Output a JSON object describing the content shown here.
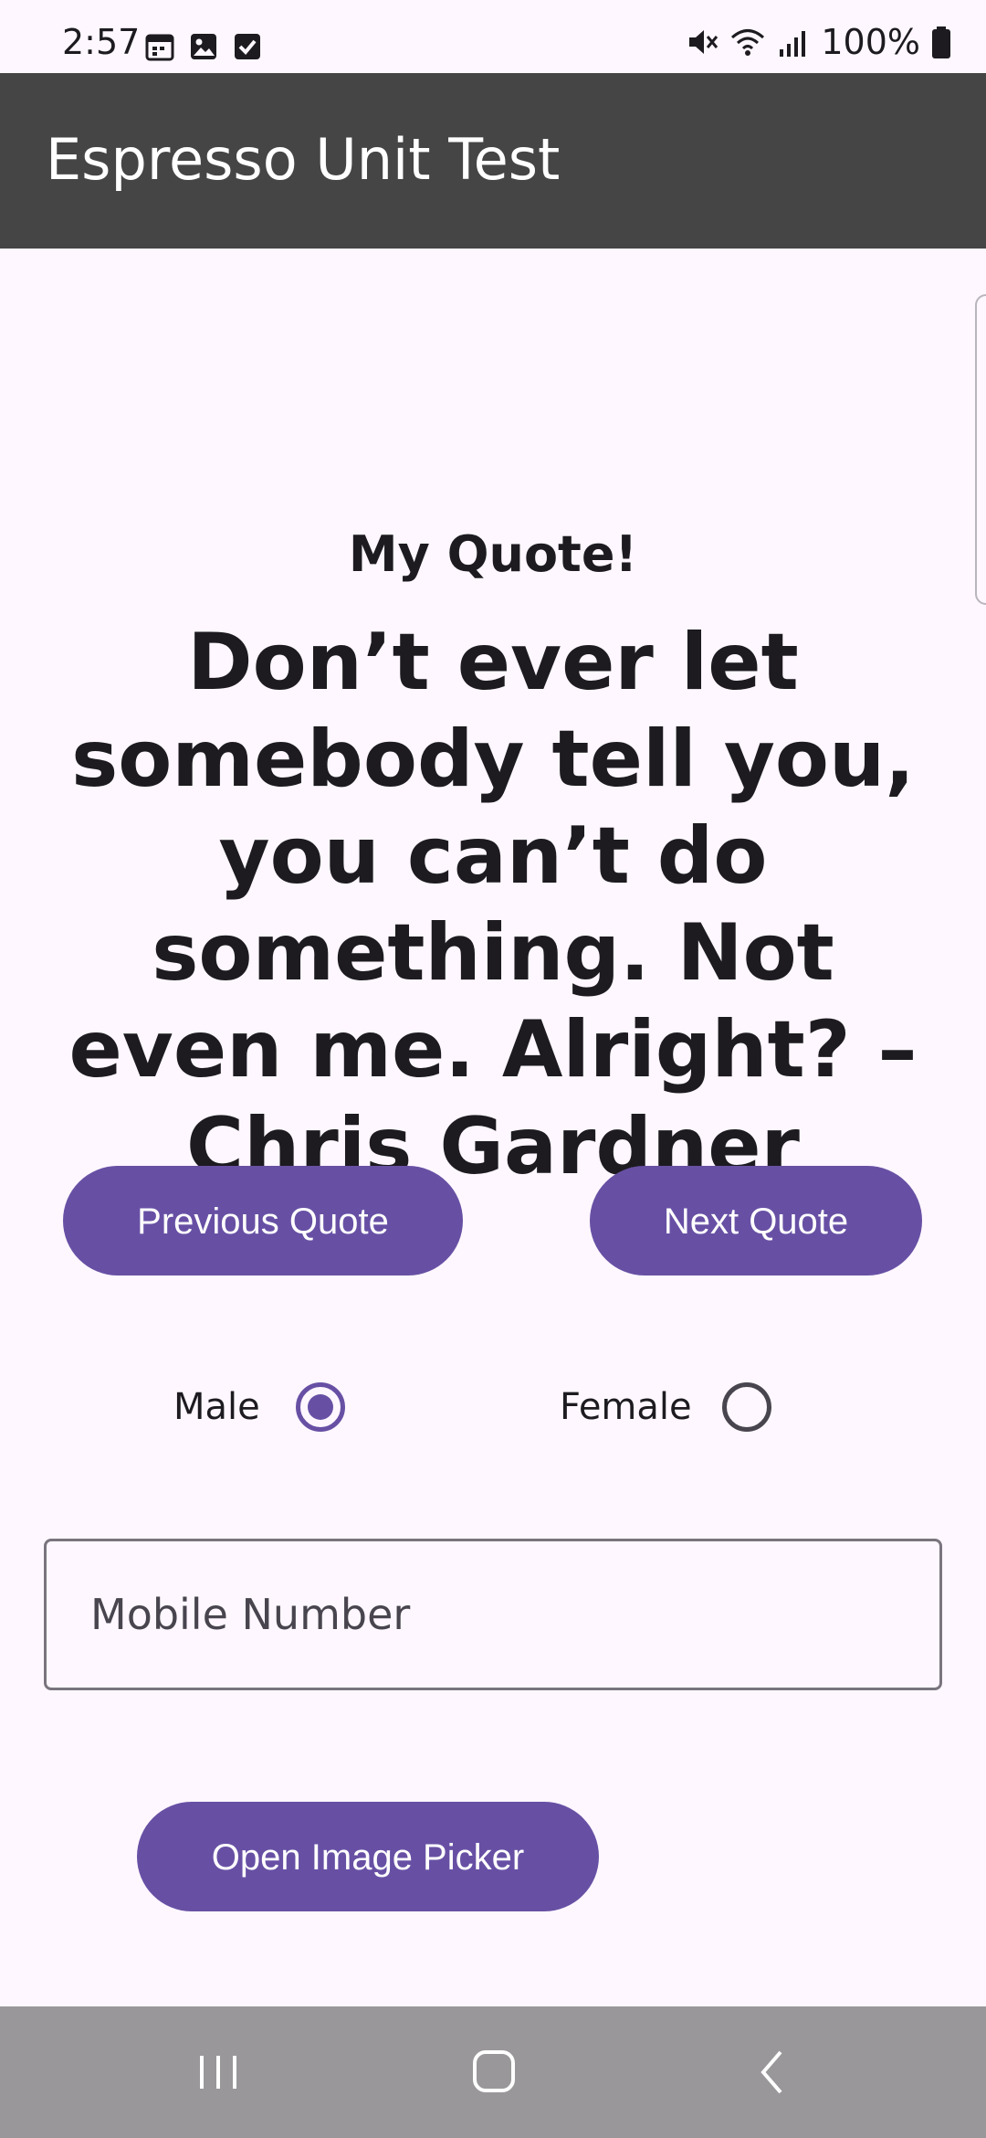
{
  "status_bar": {
    "time": "2:57",
    "battery": "100%",
    "left_icons": [
      "calendar-icon",
      "image-icon",
      "checkbox-icon"
    ],
    "right_icons": [
      "mute-icon",
      "wifi-icon",
      "signal-icon",
      "battery-icon"
    ]
  },
  "app_bar": {
    "title": "Espresso Unit Test",
    "background": "#454545"
  },
  "quote": {
    "heading": "My Quote!",
    "text": "Don’t ever let somebody tell you, you can’t do something. Not even me. Alright? – Chris Gardner"
  },
  "buttons": {
    "previous": "Previous Quote",
    "next": "Next Quote",
    "image_picker": "Open Image Picker",
    "color": "#6750a4"
  },
  "gender": {
    "male_label": "Male",
    "female_label": "Female",
    "selected": "Male"
  },
  "mobile_input": {
    "placeholder": "Mobile Number",
    "value": ""
  },
  "nav_bar": {
    "icons": [
      "recents-icon",
      "home-icon",
      "back-icon"
    ]
  }
}
